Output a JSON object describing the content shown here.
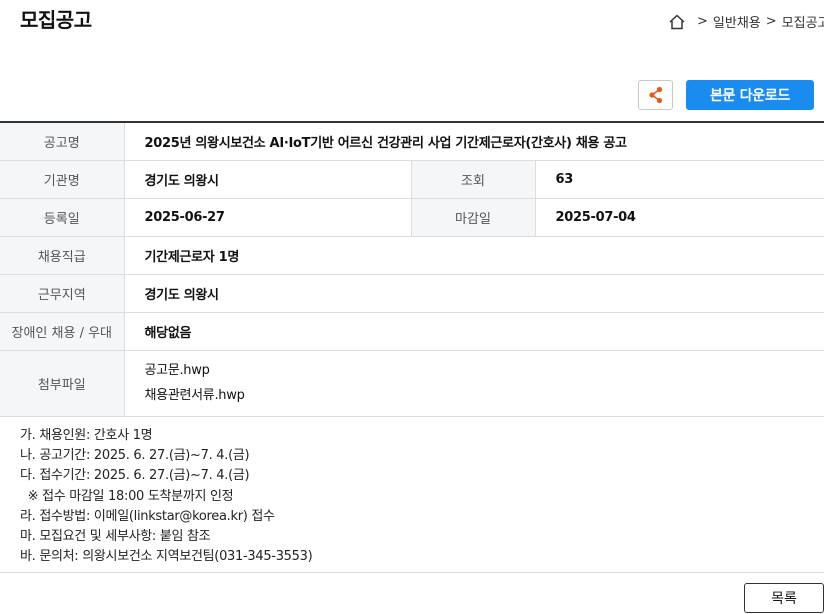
{
  "page": {
    "title": "모집공고"
  },
  "breadcrumb": {
    "items": [
      "일반채용",
      "모집공고"
    ],
    "separator": ">"
  },
  "toolbar": {
    "download_label": "본문 다운로드",
    "share_color": "#e85a1c"
  },
  "details": {
    "title_label": "공고명",
    "title_value": "2025년 의왕시보건소 AI·IoT기반 어르신 건강관리 사업 기간제근로자(간호사) 채용 공고",
    "org_label": "기관명",
    "org_value": "경기도 의왕시",
    "views_label": "조회",
    "views_value": "63",
    "reg_label": "등록일",
    "reg_value": "2025-06-27",
    "deadline_label": "마감일",
    "deadline_value": "2025-07-04",
    "rank_label": "채용직급",
    "rank_value": "기간제근로자 1명",
    "region_label": "근무지역",
    "region_value": "경기도 의왕시",
    "disability_label": "장애인 채용 / 우대",
    "disability_value": "해당없음",
    "attach_label": "첨부파일",
    "attachments": [
      "공고문.hwp",
      "채용관련서류.hwp"
    ]
  },
  "body_lines": [
    "가. 채용인원: 간호사 1명",
    "나. 공고기간: 2025. 6. 27.(금)~7. 4.(금)",
    "다. 접수기간: 2025. 6. 27.(금)~7. 4.(금)",
    "  ※ 접수 마감일 18:00 도착분까지 인정",
    "라. 접수방법: 이메일(linkstar@korea.kr) 접수",
    "마. 모집요건 및 세부사항: 붙임 참조",
    "바. 문의처: 의왕시보건소 지역보건팀(031-345-3553)"
  ],
  "footer": {
    "list_label": "목록"
  }
}
